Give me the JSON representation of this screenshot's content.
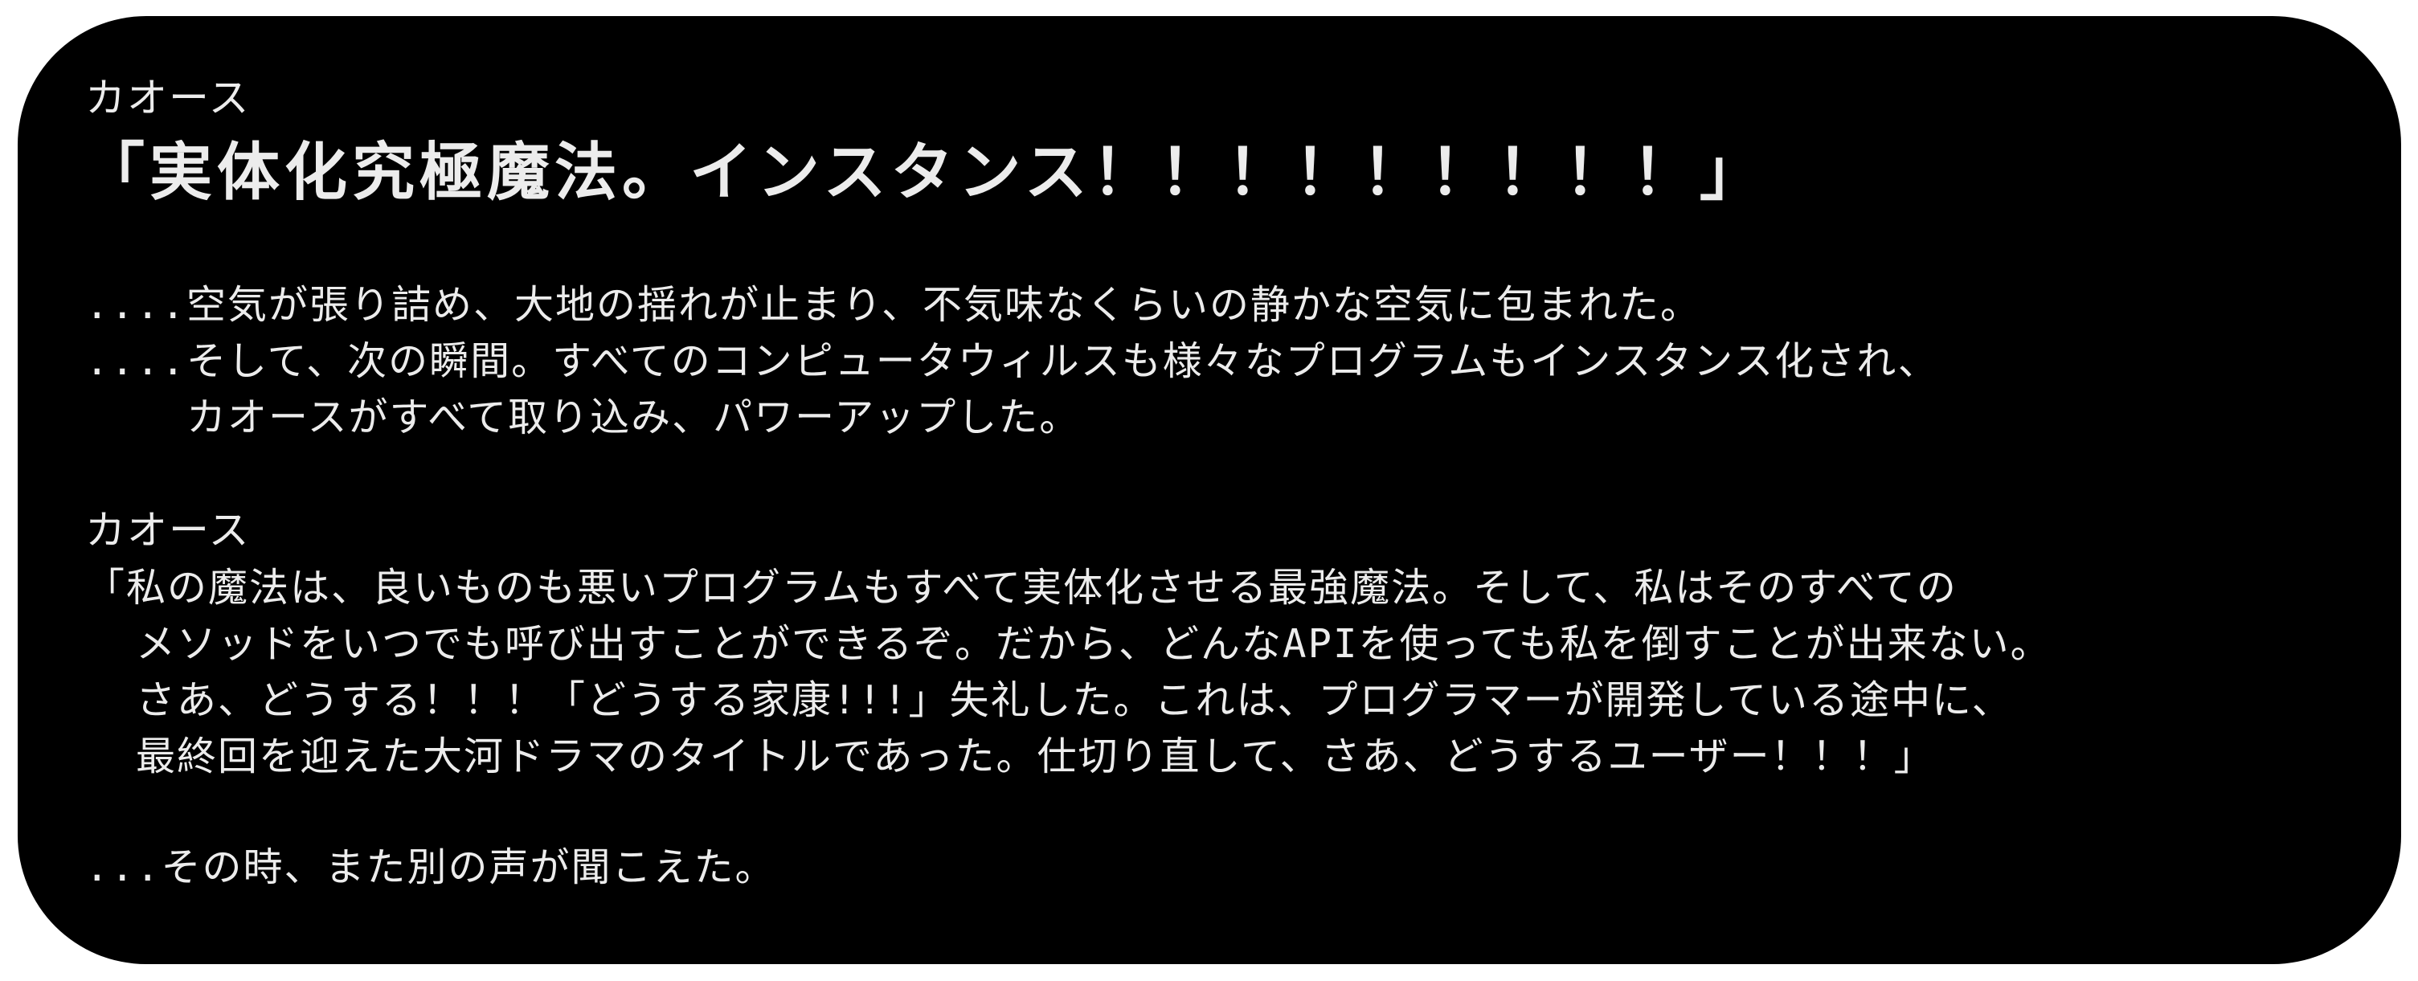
{
  "dialog": {
    "block1": {
      "speaker": "カオース",
      "shout": "「実体化究極魔法。インスタンス！！！！！！！！！」"
    },
    "narration1": {
      "line1": "....空気が張り詰め、大地の揺れが止まり、不気味なくらいの静かな空気に包まれた。",
      "line2": "....そして、次の瞬間。すべてのコンピュータウィルスも様々なプログラムもインスタンス化され、",
      "line3": "    カオースがすべて取り込み、パワーアップした。"
    },
    "block2": {
      "speaker": "カオース",
      "line1": "「私の魔法は、良いものも悪いプログラムもすべて実体化させる最強魔法。そして、私はそのすべての",
      "line2": "  メソッドをいつでも呼び出すことができるぞ。だから、どんなAPIを使っても私を倒すことが出来ない。",
      "line3": "  さあ、どうする！！！「どうする家康!!!」失礼した。これは、プログラマーが開発している途中に、",
      "line4": "  最終回を迎えた大河ドラマのタイトルであった。仕切り直して、さあ、どうするユーザー！！！」"
    },
    "narration2": {
      "line1": "...その時、また別の声が聞こえた。"
    }
  }
}
